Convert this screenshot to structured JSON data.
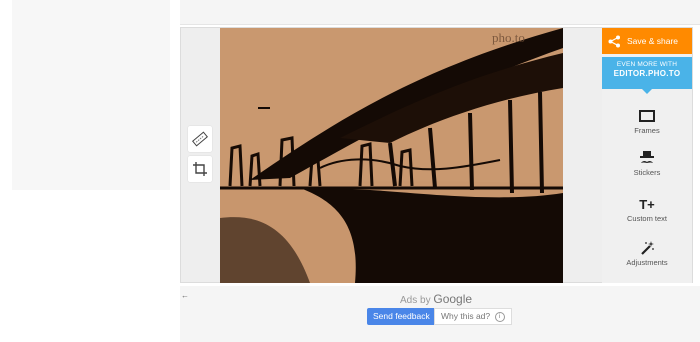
{
  "photo": {
    "watermark": "pho.to"
  },
  "left_tools": [
    {
      "icon": "photo-tag-icon"
    },
    {
      "icon": "crop-icon"
    }
  ],
  "sidebar": {
    "save_share_label": "Save & share",
    "promo_line1": "EVEN MORE WITH",
    "promo_line2": "EDITOR.PHO.TO",
    "items": [
      {
        "label": "Frames",
        "icon": "frames-icon"
      },
      {
        "label": "Stickers",
        "icon": "stickers-icon"
      },
      {
        "label": "Custom text",
        "icon": "custom-text-icon",
        "glyph": "T+"
      },
      {
        "label": "Adjustments",
        "icon": "adjustments-icon"
      }
    ]
  },
  "ads": {
    "ads_by": "Ads by",
    "google": "Google",
    "send_feedback": "Send feedback",
    "why_this_ad": "Why this ad?",
    "back": "←"
  },
  "colors": {
    "accent": "#ff8a00",
    "promo": "#4ab3e8",
    "feedback": "#4a86e8",
    "photo_tone": "#c9986f"
  }
}
